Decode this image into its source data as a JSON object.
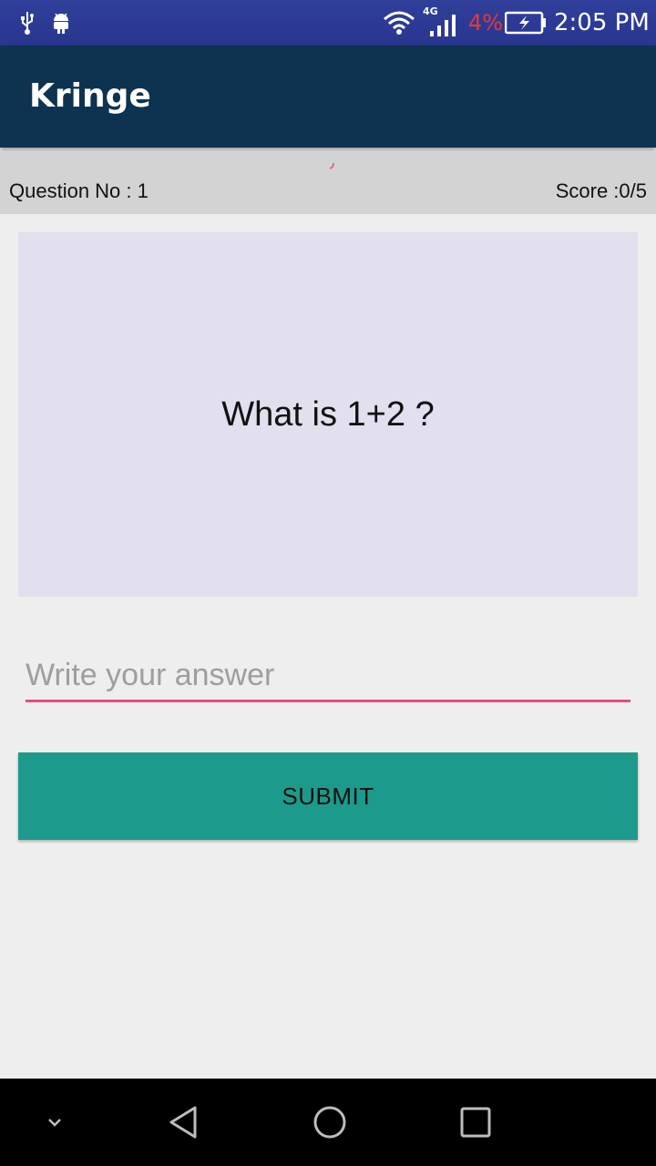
{
  "status_bar": {
    "network_type": "4G",
    "battery_percent": "4%",
    "time": "2:05 PM",
    "icons": [
      "usb-icon",
      "android-debug-icon",
      "wifi-icon",
      "signal-icon",
      "battery-charging-icon"
    ],
    "battery_color": "#e53935"
  },
  "app_bar": {
    "title": "Kringe",
    "color": "#0e3350"
  },
  "info_bar": {
    "question_label": "Question No : 1",
    "score_label": "Score :0/5"
  },
  "question": {
    "text": "What is 1+2 ?",
    "card_color": "#e2dfee"
  },
  "answer": {
    "placeholder": "Write your answer",
    "value": "",
    "accent_color": "#ef4a80"
  },
  "submit": {
    "label": "SUBMIT",
    "color": "#1c9a8b"
  },
  "nav_bar": {
    "icons": [
      "hide-keyboard-icon",
      "back-icon",
      "home-icon",
      "recent-apps-icon"
    ]
  }
}
